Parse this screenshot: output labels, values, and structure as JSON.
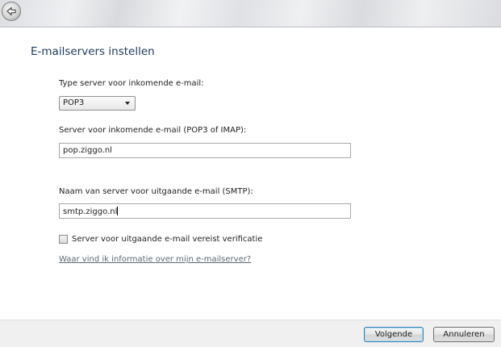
{
  "header": {
    "back_icon": "back-arrow-icon"
  },
  "page": {
    "title": "E-mailservers instellen"
  },
  "incoming_type": {
    "label": "Type server voor inkomende e-mail:",
    "selected": "POP3"
  },
  "incoming_server": {
    "label": "Server voor inkomende e-mail (POP3 of IMAP):",
    "value": "pop.ziggo.nl"
  },
  "outgoing_server": {
    "label": "Naam van server voor uitgaande e-mail (SMTP):",
    "value": "smtp.ziggo.nl"
  },
  "auth_checkbox": {
    "label": "Server voor uitgaande e-mail vereist verificatie",
    "checked": false
  },
  "help_link": {
    "text": "Waar vind ik informatie over mijn e-mailserver?"
  },
  "footer": {
    "next_label": "Volgende",
    "cancel_label": "Annuleren"
  },
  "colors": {
    "title_text": "#1e395b",
    "link_text": "#5b6770",
    "footer_bg": "#f0f0f0"
  }
}
